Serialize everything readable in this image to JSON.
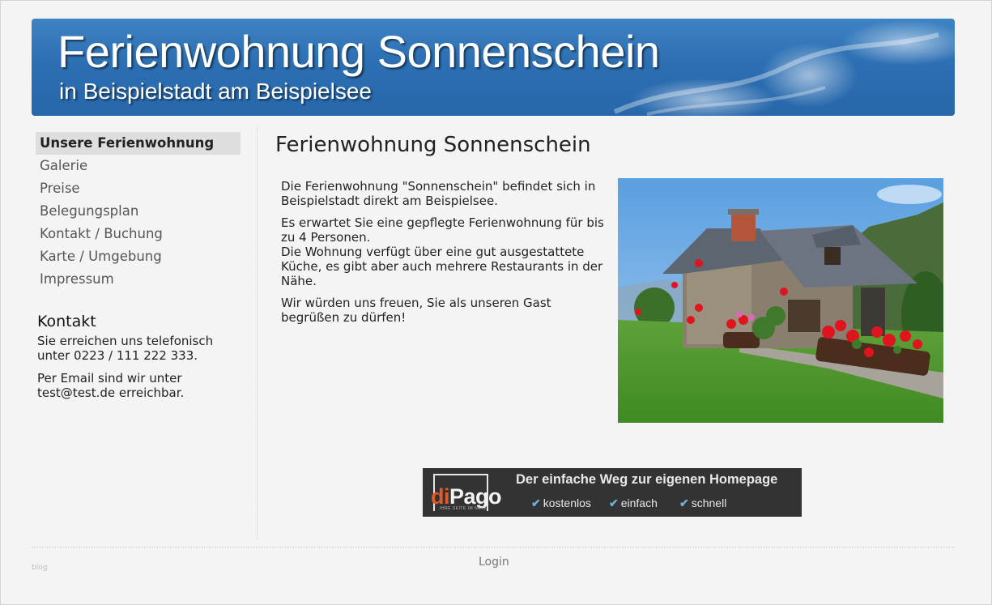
{
  "header": {
    "title": "Ferienwohnung Sonnenschein",
    "subtitle": "in Beispielstadt am Beispielsee"
  },
  "nav": {
    "items": [
      {
        "label": "Unsere Ferienwohnung",
        "active": true
      },
      {
        "label": "Galerie"
      },
      {
        "label": "Preise"
      },
      {
        "label": "Belegungsplan"
      },
      {
        "label": "Kontakt / Buchung"
      },
      {
        "label": "Karte / Umgebung"
      },
      {
        "label": "Impressum"
      }
    ]
  },
  "contact": {
    "heading": "Kontakt",
    "phone_text": "Sie erreichen uns telefonisch unter 0223 / 111 222 333.",
    "email_text": "Per Email sind wir unter test@test.de erreichbar."
  },
  "main": {
    "title": "Ferienwohnung Sonnenschein",
    "paragraphs": [
      "Die Ferienwohnung \"Sonnenschein\" befindet sich in Beispielstadt direkt am Beispielsee.",
      "Es erwartet Sie eine gepflegte Ferienwohnung für bis zu 4 Personen.",
      "Die Wohnung verfügt über eine gut ausgestattete Küche, es gibt aber auch mehrere Restaurants in der Nähe.",
      "Wir würden uns freuen, Sie als unseren Gast begrüßen zu dürfen!"
    ]
  },
  "ad": {
    "logo_di": "di",
    "logo_pago": "Pago",
    "logo_tagline": "IHRE SEITE IM NETZ",
    "headline": "Der einfache Weg zur eigenen Homepage",
    "features": [
      "kostenlos",
      "einfach",
      "schnell"
    ]
  },
  "footer": {
    "blog": "blog",
    "login": "Login"
  },
  "colors": {
    "banner_blue": "#2c6fb3",
    "ad_background": "#333333",
    "ad_accent": "#e05a2b",
    "check_color": "#6fb0d8"
  }
}
